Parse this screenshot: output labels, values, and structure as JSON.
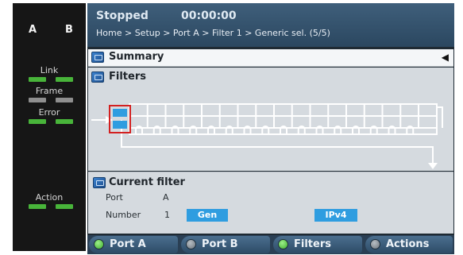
{
  "ports": {
    "a": "A",
    "b": "B"
  },
  "leds": {
    "link": "Link",
    "frame": "Frame",
    "error": "Error",
    "action": "Action"
  },
  "status": {
    "state": "Stopped",
    "timer": "00:00:00",
    "breadcrumb": "Home > Setup > Port A > Filter 1 > Generic sel. (5/5)"
  },
  "summary": {
    "title": "Summary",
    "arrow_icon": "triangle-left-icon"
  },
  "filters": {
    "title": "Filters",
    "diagram_icon": "filter-chain-diagram"
  },
  "current_filter": {
    "title": "Current filter",
    "port_label": "Port",
    "port_value": "A",
    "number_label": "Number",
    "number_value": "1",
    "type_chip": "Gen",
    "protocol_chip": "IPv4"
  },
  "tabs": [
    {
      "label": "Port A",
      "indicator": "green"
    },
    {
      "label": "Port B",
      "indicator": "gray"
    },
    {
      "label": "Filters",
      "indicator": "green"
    },
    {
      "label": "Actions",
      "indicator": "gray"
    }
  ],
  "colors": {
    "led_on": "#48b43a",
    "led_off": "#8f8f8f",
    "chip": "#2f9de0",
    "selected_filter": "#d32020"
  }
}
